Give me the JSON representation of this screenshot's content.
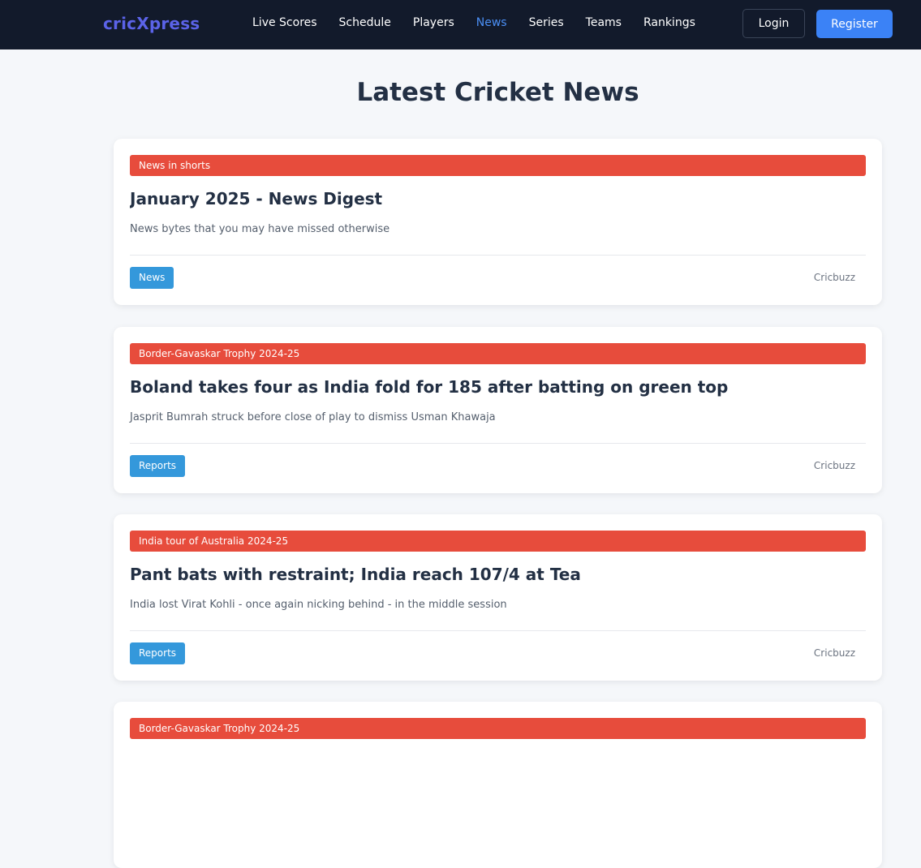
{
  "nav": {
    "brand": "cricXpress",
    "links": [
      "Live Scores",
      "Schedule",
      "Players",
      "News",
      "Series",
      "Teams",
      "Rankings"
    ],
    "active": "News",
    "login_label": "Login",
    "register_label": "Register"
  },
  "colors": {
    "navbar": "#121a2b",
    "brand": "#5b63e8",
    "active_link": "#4b8ff5",
    "register": "#3b82f6",
    "category_bar": "#e74c3c",
    "tag": "#3498db",
    "background": "#f5f7fa"
  },
  "page": {
    "title": "Latest Cricket News"
  },
  "articles": [
    {
      "category": "News in shorts",
      "title": "January 2025 - News Digest",
      "description": "News bytes that you may have missed otherwise",
      "tag": "News",
      "source": "Cricbuzz"
    },
    {
      "category": "Border-Gavaskar Trophy 2024-25",
      "title": "Boland takes four as India fold for 185 after batting on green top",
      "description": "Jasprit Bumrah struck before close of play to dismiss Usman Khawaja",
      "tag": "Reports",
      "source": "Cricbuzz"
    },
    {
      "category": "India tour of Australia 2024-25",
      "title": "Pant bats with restraint; India reach 107/4 at Tea",
      "description": "India lost Virat Kohli - once again nicking behind - in the middle session",
      "tag": "Reports",
      "source": "Cricbuzz"
    },
    {
      "category": "Border-Gavaskar Trophy 2024-25"
    }
  ]
}
